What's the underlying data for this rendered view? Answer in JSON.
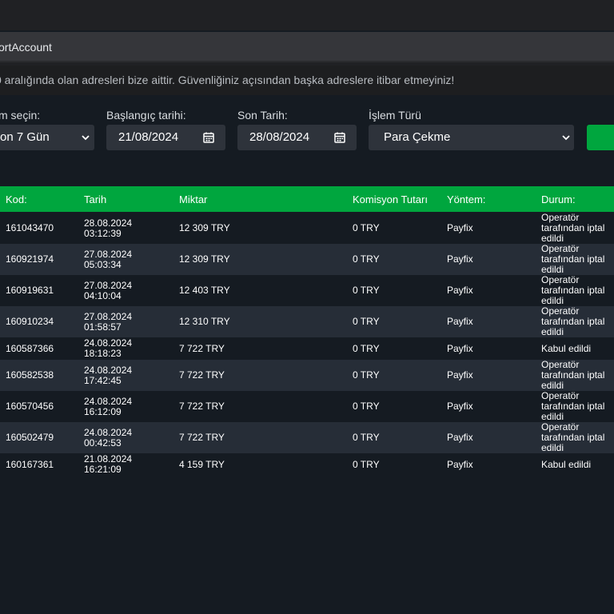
{
  "browser": {
    "address_text": "ortAccount"
  },
  "notice": {
    "text": "0 aralığında olan adresleri bize aittir. Güvenliğiniz açısından başka adreslere itibar etmeyiniz!"
  },
  "filters": {
    "period_label": "m seçin:",
    "period_value": "on 7 Gün",
    "start_label": "Başlangıç tarihi:",
    "start_value": "21/08/2024",
    "end_label": "Son Tarih:",
    "end_value": "28/08/2024",
    "type_label": "İşlem Türü",
    "type_value": "Para Çekme"
  },
  "table": {
    "headers": {
      "kod": "Kod:",
      "tarih": "Tarih",
      "miktar": "Miktar",
      "komisyon": "Komisyon Tutarı",
      "yontem": "Yöntem:",
      "durum": "Durum:"
    },
    "rows": [
      {
        "kod": "161043470",
        "date": "28.08.2024",
        "time": "03:12:39",
        "miktar": "12 309 TRY",
        "komisyon": "0 TRY",
        "yontem": "Payfix",
        "durum": "Operatör tarafından iptal edildi"
      },
      {
        "kod": "160921974",
        "date": "27.08.2024",
        "time": "05:03:34",
        "miktar": "12 309 TRY",
        "komisyon": "0 TRY",
        "yontem": "Payfix",
        "durum": "Operatör tarafından iptal edildi"
      },
      {
        "kod": "160919631",
        "date": "27.08.2024",
        "time": "04:10:04",
        "miktar": "12 403 TRY",
        "komisyon": "0 TRY",
        "yontem": "Payfix",
        "durum": "Operatör tarafından iptal edildi"
      },
      {
        "kod": "160910234",
        "date": "27.08.2024",
        "time": "01:58:57",
        "miktar": "12 310 TRY",
        "komisyon": "0 TRY",
        "yontem": "Payfix",
        "durum": "Operatör tarafından iptal edildi"
      },
      {
        "kod": "160587366",
        "date": "24.08.2024",
        "time": "18:18:23",
        "miktar": "7 722 TRY",
        "komisyon": "0 TRY",
        "yontem": "Payfix",
        "durum": "Kabul edildi"
      },
      {
        "kod": "160582538",
        "date": "24.08.2024",
        "time": "17:42:45",
        "miktar": "7 722 TRY",
        "komisyon": "0 TRY",
        "yontem": "Payfix",
        "durum": "Operatör tarafından iptal edildi"
      },
      {
        "kod": "160570456",
        "date": "24.08.2024",
        "time": "16:12:09",
        "miktar": "7 722 TRY",
        "komisyon": "0 TRY",
        "yontem": "Payfix",
        "durum": "Operatör tarafından iptal edildi"
      },
      {
        "kod": "160502479",
        "date": "24.08.2024",
        "time": "00:42:53",
        "miktar": "7 722 TRY",
        "komisyon": "0 TRY",
        "yontem": "Payfix",
        "durum": "Operatör tarafından iptal edildi"
      },
      {
        "kod": "160167361",
        "date": "21.08.2024",
        "time": "16:21:09",
        "miktar": "4 159 TRY",
        "komisyon": "0 TRY",
        "yontem": "Payfix",
        "durum": "Kabul edildi"
      }
    ]
  },
  "colors": {
    "accent_green": "#00a63e",
    "background": "#151b22",
    "row_alt": "#262d37",
    "input_bg": "#2e333b"
  },
  "icons": {
    "calendar": "calendar-icon",
    "chevron": "chevron-down-icon"
  }
}
